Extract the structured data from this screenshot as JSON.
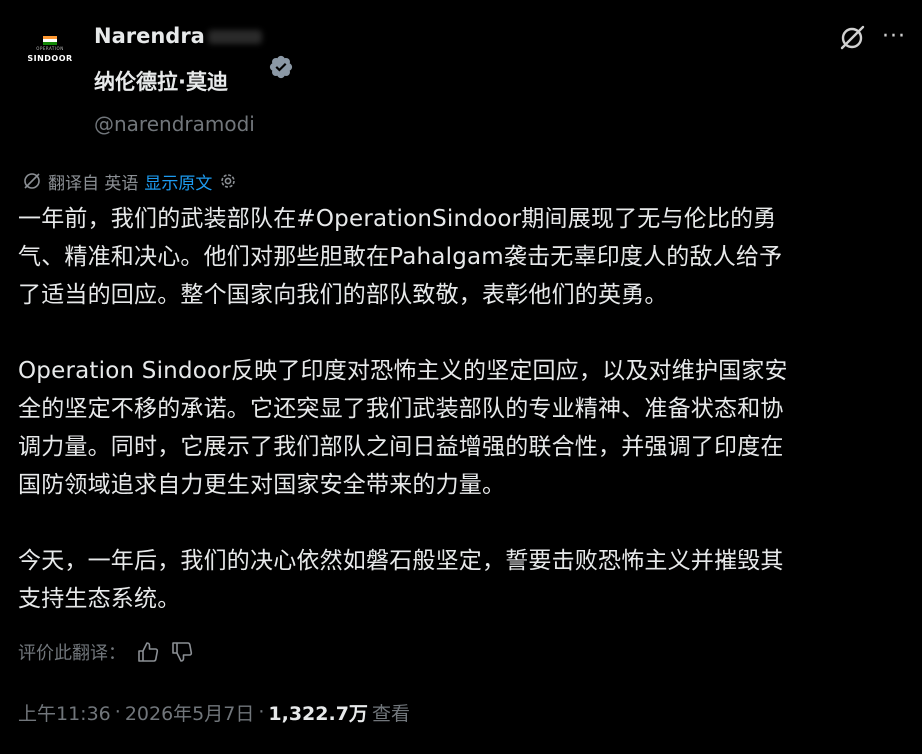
{
  "header": {
    "display_name": "Narendra",
    "chinese_name": "纳伦德拉·莫迪",
    "handle": "@narendramodi",
    "avatar": {
      "subtext": "OPERATION",
      "brand": "SINDOOR",
      "flag_colors": [
        "#ff9933",
        "#ffffff",
        "#138808"
      ]
    },
    "icons": {
      "verified": "verified-badge-icon",
      "grok": "grok-icon",
      "more": "more-icon"
    },
    "more_glyph": "···"
  },
  "translation": {
    "label": "翻译自 英语",
    "show_original": "显示原文",
    "icons": {
      "translate": "translate-icon",
      "settings": "gear-icon"
    }
  },
  "body": {
    "paragraphs": [
      "一年前，我们的武装部队在#OperationSindoor期间展现了无与伦比的勇\n气、精准和决心。他们对那些胆敢在Pahalgam袭击无辜印度人的敌人给予\n了适当的回应。整个国家向我们的部队致敬，表彰他们的英勇。",
      "Operation Sindoor反映了印度对恐怖主义的坚定回应，以及对维护国家安\n全的坚定不移的承诺。它还突显了我们武装部队的专业精神、准备状态和协\n调力量。同时，它展示了我们部队之间日益增强的联合性，并强调了印度在\n国防领域追求自力更生对国家安全带来的力量。",
      "今天，一年后，我们的决心依然如磐石般坚定，誓要击败恐怖主义并摧毁其\n支持生态系统。"
    ]
  },
  "rate": {
    "label": "评价此翻译："
  },
  "meta": {
    "time": "上午11:36",
    "sep": "·",
    "date": "2026年5月7日",
    "views": "1,322.7万",
    "views_label": "查看"
  },
  "colors": {
    "background": "#000000",
    "text": "#e7e9ea",
    "muted": "#71767b",
    "link": "#1d9bf0",
    "verified": "#8b98a5"
  }
}
